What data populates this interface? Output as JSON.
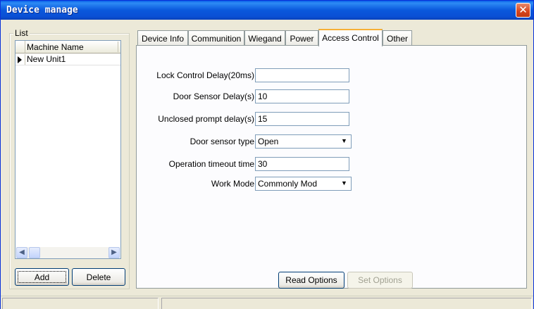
{
  "window": {
    "title": "Device manage",
    "close_glyph": "✕"
  },
  "list_panel": {
    "legend": "List",
    "column_header": "Machine Name",
    "rows": [
      {
        "name": "New Unit1",
        "selected_indicator": true
      }
    ],
    "scroll_left": "◀",
    "scroll_right": "▶",
    "add_button": "Add",
    "delete_button": "Delete"
  },
  "tabs": [
    {
      "label": "Device Info",
      "active": false
    },
    {
      "label": "Communition",
      "active": false
    },
    {
      "label": "Wiegand",
      "active": false
    },
    {
      "label": "Power",
      "active": false
    },
    {
      "label": "Access Control",
      "active": true
    },
    {
      "label": "Other",
      "active": false
    }
  ],
  "access_control": {
    "lock_delay": {
      "label": "Lock Control Delay(20ms)",
      "value": ""
    },
    "door_sensor_delay": {
      "label": "Door Sensor Delay(s)",
      "value": "10"
    },
    "unclosed_prompt_delay": {
      "label": "Unclosed prompt delay(s)",
      "value": "15"
    },
    "door_sensor_type": {
      "label": "Door sensor type",
      "value": "Open"
    },
    "operation_timeout": {
      "label": "Operation timeout time",
      "value": "30"
    },
    "work_mode": {
      "label": "Work Mode",
      "value": "Commonly Mod"
    },
    "read_button": "Read Options",
    "set_button": "Set Options"
  },
  "icons": {
    "dropdown_arrow": "▼"
  },
  "colors": {
    "titlebar": "#0a58dc",
    "close": "#d8441c",
    "tab_active_accent": "#f7b036"
  }
}
